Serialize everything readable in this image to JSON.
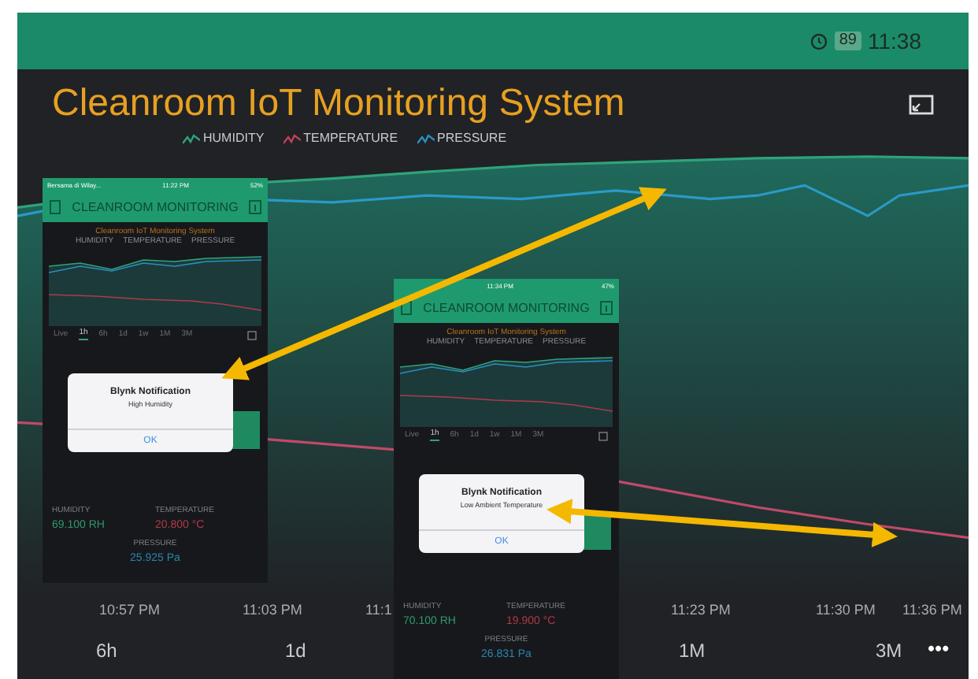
{
  "status_bar": {
    "battery": "89",
    "time": "11:38"
  },
  "dashboard": {
    "title": "Cleanroom IoT Monitoring System",
    "legend": [
      {
        "label": "HUMIDITY",
        "color": "#2fa37a"
      },
      {
        "label": "TEMPERATURE",
        "color": "#c0405a"
      },
      {
        "label": "PRESSURE",
        "color": "#2a8fc0"
      }
    ],
    "x_labels": [
      "10:57 PM",
      "11:03 PM",
      "11:1",
      "11:23 PM",
      "11:30 PM",
      "11:36 PM"
    ],
    "ranges": [
      "6h",
      "1d",
      "1M",
      "3M"
    ],
    "more": "•••"
  },
  "phones": [
    {
      "status": {
        "carrier": "Bersama di Wilay...",
        "time": "11:22 PM",
        "battery": "52%"
      },
      "header": "CLEANROOM MONITORING",
      "chart_title": "Cleanroom IoT Monitoring System",
      "legend": [
        "HUMIDITY",
        "TEMPERATURE",
        "PRESSURE"
      ],
      "ranges": [
        {
          "label": "Live",
          "selected": false
        },
        {
          "label": "1h",
          "selected": true
        },
        {
          "label": "6h",
          "selected": false
        },
        {
          "label": "1d",
          "selected": false
        },
        {
          "label": "1w",
          "selected": false
        },
        {
          "label": "1M",
          "selected": false
        },
        {
          "label": "3M",
          "selected": false
        }
      ],
      "notification": {
        "title": "Blynk Notification",
        "message": "High Humidity",
        "button": "OK"
      },
      "readings": [
        {
          "label": "HUMIDITY",
          "value": "69.100 RH",
          "color": "#2e9a6a"
        },
        {
          "label": "TEMPERATURE",
          "value": "20.800 °C",
          "color": "#b03a48"
        },
        {
          "label": "PRESSURE",
          "value": "25.925 Pa",
          "color": "#2a86b0"
        }
      ]
    },
    {
      "status": {
        "time": "11:34 PM",
        "battery": "47%"
      },
      "header": "CLEANROOM MONITORING",
      "chart_title": "Cleanroom IoT Monitoring System",
      "legend": [
        "HUMIDITY",
        "TEMPERATURE",
        "PRESSURE"
      ],
      "ranges": [
        {
          "label": "Live",
          "selected": false
        },
        {
          "label": "1h",
          "selected": true
        },
        {
          "label": "6h",
          "selected": false
        },
        {
          "label": "1d",
          "selected": false
        },
        {
          "label": "1w",
          "selected": false
        },
        {
          "label": "1M",
          "selected": false
        },
        {
          "label": "3M",
          "selected": false
        }
      ],
      "notification": {
        "title": "Blynk Notification",
        "message": "Low Ambient Temperature",
        "button": "OK"
      },
      "readings": [
        {
          "label": "HUMIDITY",
          "value": "70.100 RH",
          "color": "#2e9a6a"
        },
        {
          "label": "TEMPERATURE",
          "value": "19.900 °C",
          "color": "#b03a48"
        },
        {
          "label": "PRESSURE",
          "value": "26.831 Pa",
          "color": "#2a86b0"
        }
      ]
    }
  ]
}
